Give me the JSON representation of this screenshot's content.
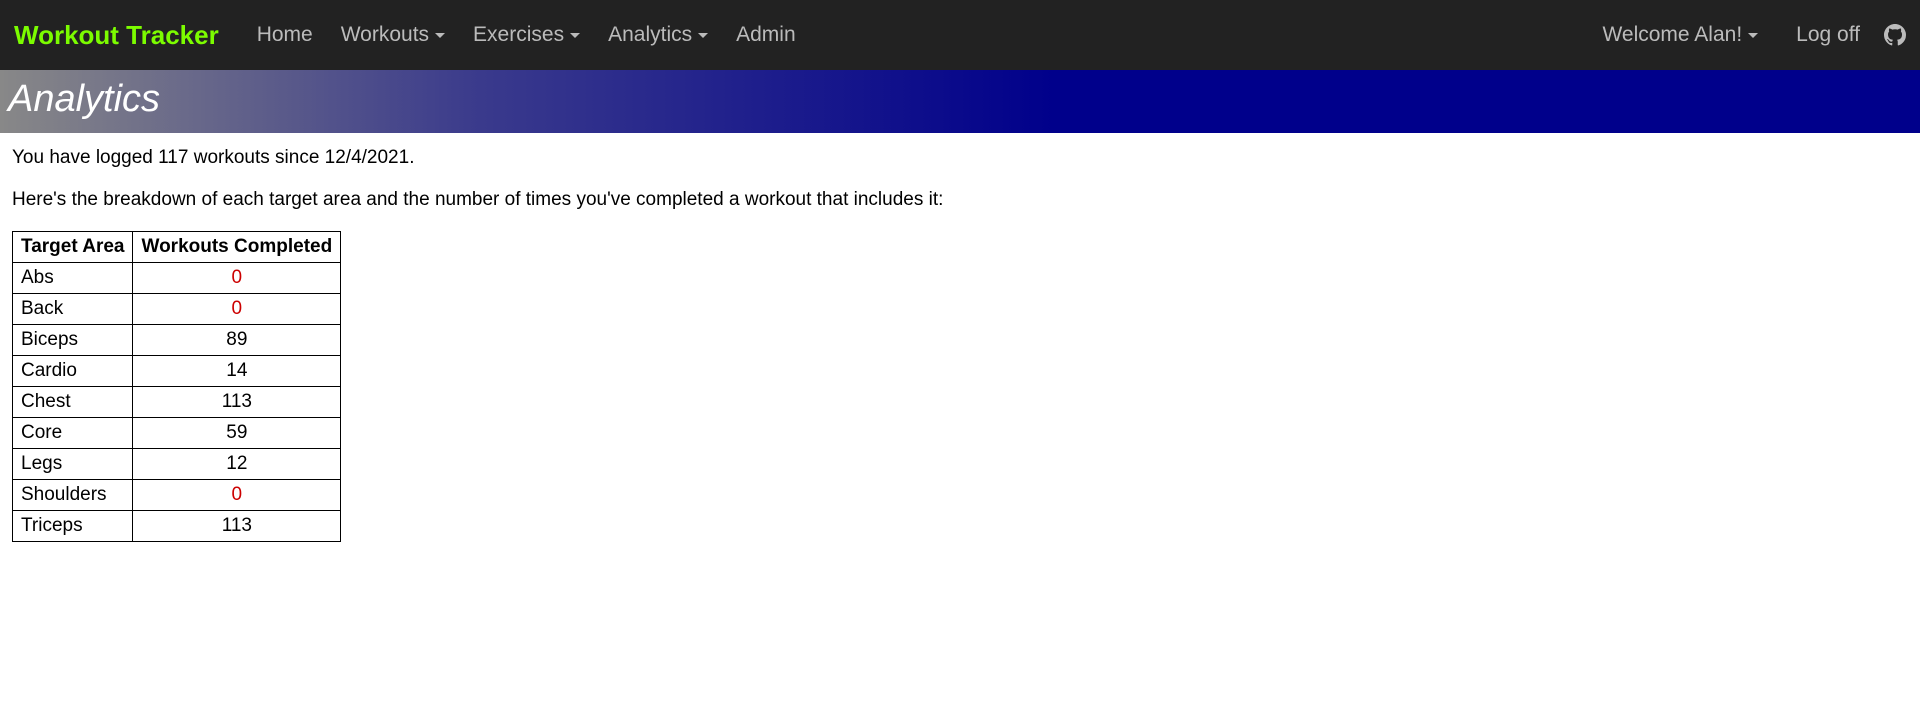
{
  "navbar": {
    "brand": "Workout Tracker",
    "items": [
      {
        "label": "Home",
        "dropdown": false
      },
      {
        "label": "Workouts",
        "dropdown": true
      },
      {
        "label": "Exercises",
        "dropdown": true
      },
      {
        "label": "Analytics",
        "dropdown": true
      },
      {
        "label": "Admin",
        "dropdown": false
      }
    ],
    "welcome": "Welcome Alan!",
    "logoff": "Log off"
  },
  "page": {
    "title": "Analytics",
    "summary": "You have logged 117 workouts since 12/4/2021.",
    "breakdownIntro": "Here's the breakdown of each target area and the number of times you've completed a workout that includes it:"
  },
  "table": {
    "headers": {
      "area": "Target Area",
      "count": "Workouts Completed"
    },
    "rows": [
      {
        "area": "Abs",
        "count": 0
      },
      {
        "area": "Back",
        "count": 0
      },
      {
        "area": "Biceps",
        "count": 89
      },
      {
        "area": "Cardio",
        "count": 14
      },
      {
        "area": "Chest",
        "count": 113
      },
      {
        "area": "Core",
        "count": 59
      },
      {
        "area": "Legs",
        "count": 12
      },
      {
        "area": "Shoulders",
        "count": 0
      },
      {
        "area": "Triceps",
        "count": 113
      }
    ]
  }
}
